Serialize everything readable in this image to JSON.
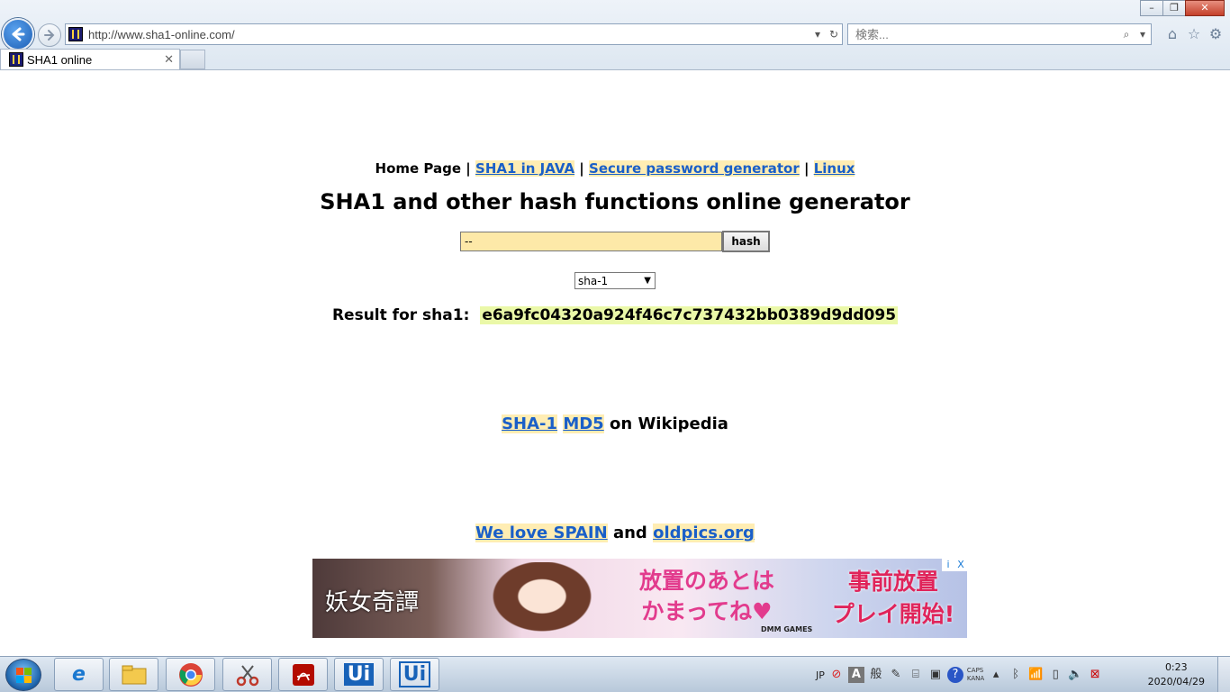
{
  "window": {
    "minimize_icon": "minimize-icon",
    "restore_icon": "restore-icon",
    "close_icon": "close-icon"
  },
  "address_bar": {
    "url": "http://www.sha1-online.com/"
  },
  "search": {
    "placeholder": "検索..."
  },
  "tab": {
    "title": "SHA1 online"
  },
  "page": {
    "nav": {
      "home": "Home Page",
      "sep": "|",
      "java": "SHA1 in JAVA",
      "password": "Secure password generator",
      "linux": "Linux"
    },
    "title": "SHA1 and other hash functions online generator",
    "form": {
      "input_value": "--",
      "button_label": "hash",
      "algorithm": "sha-1"
    },
    "result": {
      "label": "Result for sha1:",
      "hash": "e6a9fc04320a924f46c7c737432bb0389d9dd095"
    },
    "wiki": {
      "sha1": "SHA-1",
      "md5": "MD5",
      "suffix": "on Wikipedia"
    },
    "love": {
      "spain": "We love SPAIN",
      "and": "and",
      "oldpics": "oldpics.org"
    },
    "ad": {
      "left_text": "妖女奇譚",
      "mid_line1": "放置のあとは",
      "mid_line2": "かまってね♥",
      "brand": "DMM GAMES",
      "right_line1": "事前放置",
      "right_line2": "プレイ開始!",
      "choices_info": "i",
      "choices_close": "X"
    }
  },
  "taskbar": {
    "ui_label_1": "Ui",
    "ui_label_2": "Ui",
    "language": "JP",
    "ime_a": "A",
    "ime_mode": "般",
    "caps": "CAPS",
    "kana": "KANA",
    "time": "0:23",
    "date": "2020/04/29"
  },
  "colors": {
    "link": "#1a5fc8",
    "link_bg": "#ffedb3",
    "input_bg": "#fde9a8",
    "hash_bg": "#eaf8a8"
  }
}
